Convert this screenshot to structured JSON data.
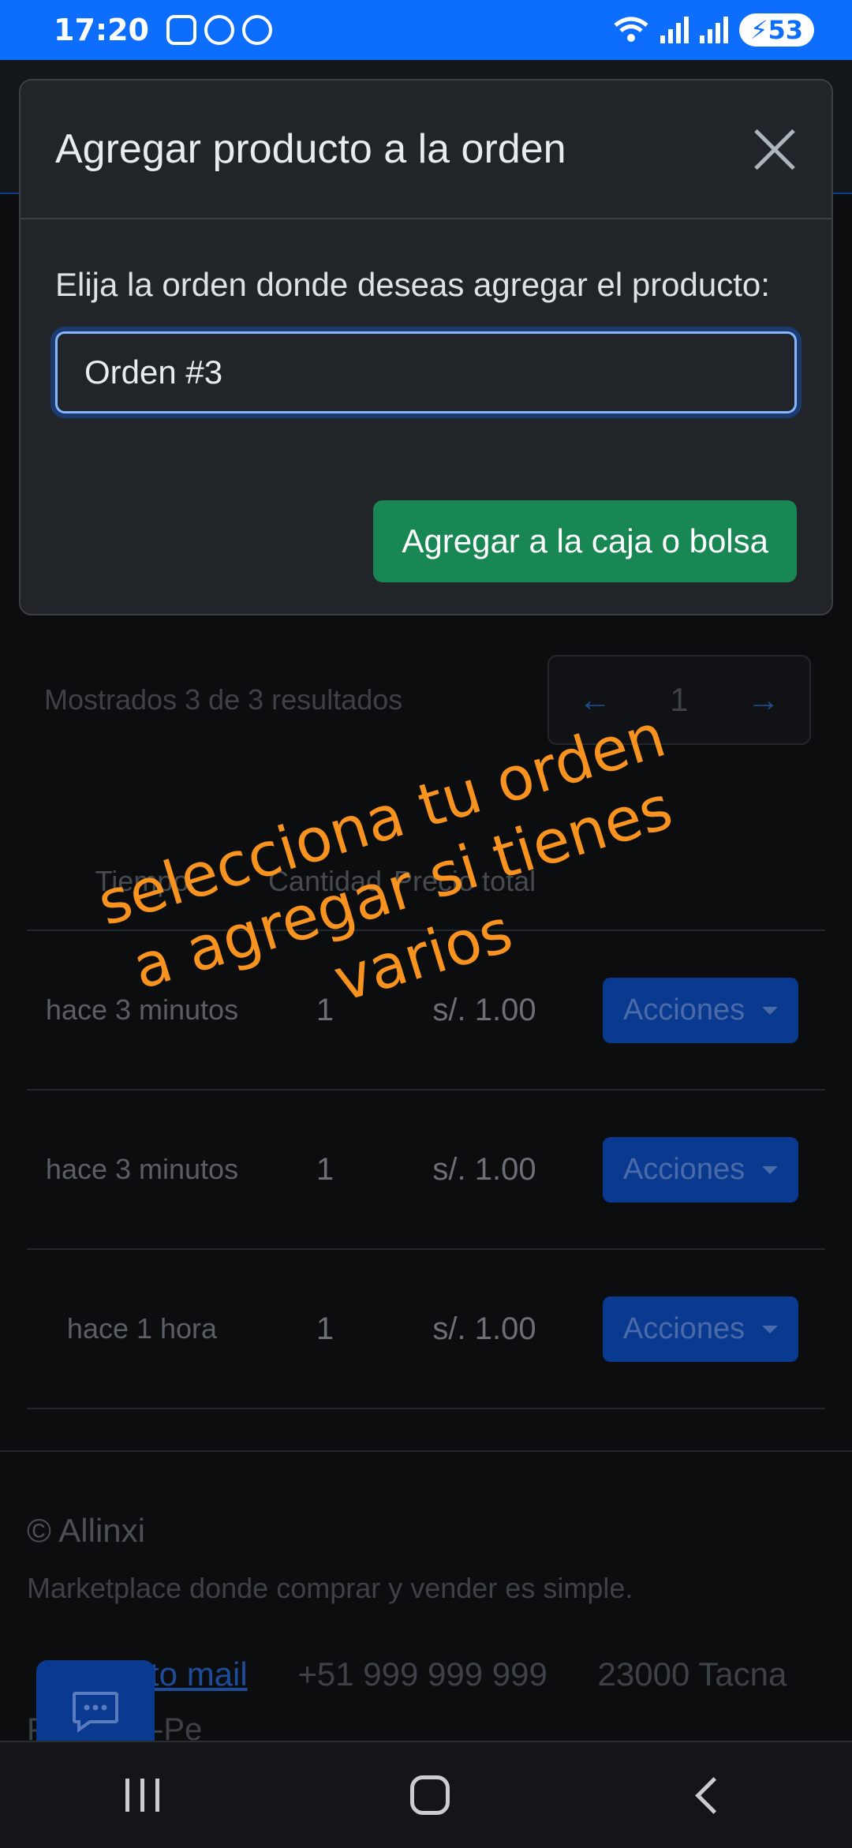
{
  "status_bar": {
    "time": "17:20",
    "battery": "53"
  },
  "modal": {
    "title": "Agregar producto a la orden",
    "label": "Elija la orden donde deseas agregar el producto:",
    "selected_order": "Orden #3",
    "submit_label": "Agregar a la caja o bolsa"
  },
  "results": {
    "summary": "Mostrados 3 de 3 resultados",
    "pager": {
      "prev": "←",
      "page": "1",
      "next": "→"
    }
  },
  "table": {
    "headers": [
      "Tiempo",
      "Cantidad",
      "Precio total"
    ],
    "rows": [
      {
        "time": "hace 3 minutos",
        "qty": "1",
        "price": "s/. 1.00",
        "action": "Acciones"
      },
      {
        "time": "hace 3 minutos",
        "qty": "1",
        "price": "s/. 1.00",
        "action": "Acciones"
      },
      {
        "time": "hace 1 hora",
        "qty": "1",
        "price": "s/. 1.00",
        "action": "Acciones"
      }
    ]
  },
  "footer": {
    "copyright": "© Allinxi",
    "tagline": "Marketplace donde comprar y vender es simple.",
    "mail_link": "to mail",
    "phone": "+51 999 999 999",
    "city": "23000 Tacna",
    "country": "Perú, ES-Pe"
  },
  "annotation": {
    "line1": "selecciona tu orden",
    "line2": "a agregar si tienes",
    "line3": "varios",
    "color": "#f7931e"
  },
  "colors": {
    "primary": "#0d6efd",
    "success": "#198754",
    "modal_bg": "#212529"
  }
}
